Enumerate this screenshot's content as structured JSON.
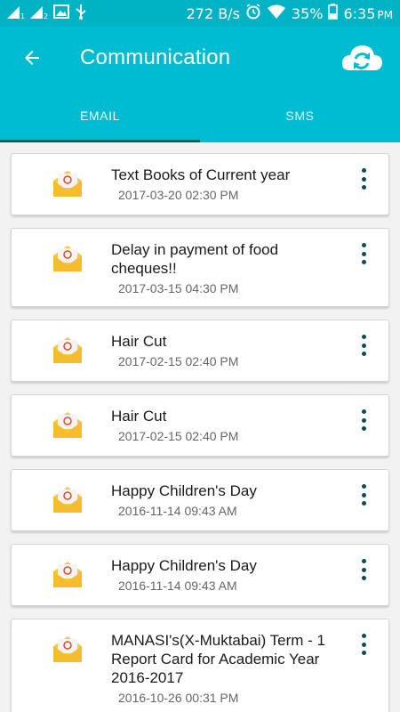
{
  "status_bar": {
    "speed": "272 B/s",
    "battery": "35%",
    "time": "6:35",
    "ampm": "PM"
  },
  "app_bar": {
    "title": "Communication"
  },
  "tabs": [
    {
      "label": "EMAIL",
      "active": true
    },
    {
      "label": "SMS",
      "active": false
    }
  ],
  "emails": [
    {
      "subject": "Text Books of Current year",
      "date": "2017-03-20 02:30 PM"
    },
    {
      "subject": "Delay in payment of food cheques!!",
      "date": "2017-03-15 04:30 PM"
    },
    {
      "subject": "Hair Cut",
      "date": "2017-02-15 02:40 PM"
    },
    {
      "subject": "Hair Cut",
      "date": "2017-02-15 02:40 PM"
    },
    {
      "subject": "Happy Children's Day",
      "date": "2016-11-14 09:43 AM"
    },
    {
      "subject": "Happy Children's Day",
      "date": "2016-11-14 09:43 AM"
    },
    {
      "subject": "MANASI's(X-Muktabai) Term - 1 Report Card for Academic Year 2016-2017",
      "date": "2016-10-26 00:31 PM"
    }
  ],
  "colors": {
    "primary": "#00bcd0",
    "tab_indicator": "#0b5563",
    "overflow_dots": "#0b4a5a",
    "envelope": "#f7c948"
  }
}
